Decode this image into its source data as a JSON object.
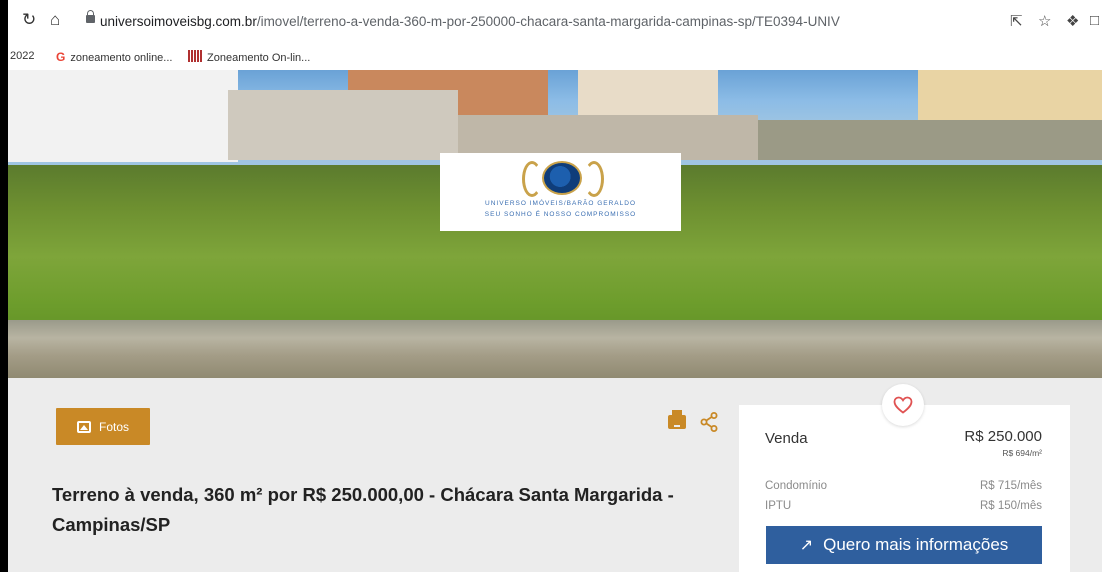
{
  "browser": {
    "url_host": "universoimoveisbg.com.br",
    "url_path": "/imovel/terreno-a-venda-360-m-por-250000-chacara-santa-margarida-campinas-sp/TE0394-UNIV",
    "icons": [
      "reload-icon",
      "home-icon",
      "lock-icon",
      "share-icon",
      "star-icon",
      "extensions-icon"
    ]
  },
  "bookmarks": {
    "items": [
      {
        "label": "2022"
      },
      {
        "label": "zoneamento online..."
      },
      {
        "label": "Zoneamento On-lin..."
      }
    ]
  },
  "hero": {
    "logo_line1": "UNIVERSO IMÓVEIS/BARÃO GERALDO",
    "logo_line2": "SEU SONHO É NOSSO COMPROMISSO"
  },
  "gallery": {
    "fotos_label": "Fotos"
  },
  "listing": {
    "title": "Terreno à venda, 360 m² por R$ 250.000,00 - Chácara Santa Margarida - Campinas/SP"
  },
  "price_card": {
    "venda_label": "Venda",
    "venda_value": "R$ 250.000",
    "venda_per_m2": "R$ 694/m²",
    "condominio_label": "Condomínio",
    "condominio_value": "R$ 715/mês",
    "iptu_label": "IPTU",
    "iptu_value": "R$ 150/mês",
    "cta_label": "Quero mais informações"
  },
  "colors": {
    "accent": "#c98926",
    "cta": "#2f5f9e",
    "heart": "#e05252"
  }
}
